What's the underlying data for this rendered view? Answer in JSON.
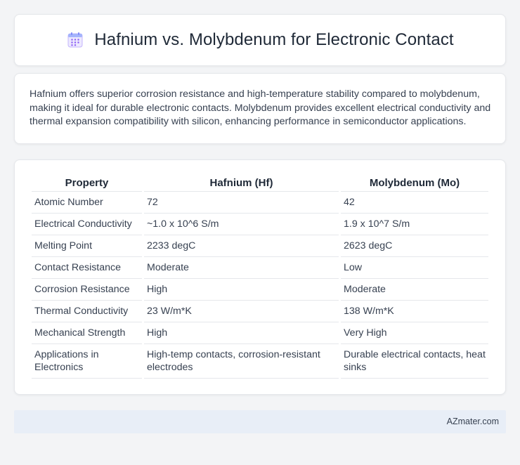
{
  "header": {
    "icon": "calendar-icon",
    "title": "Hafnium vs. Molybdenum for Electronic Contact"
  },
  "intro": {
    "text": "Hafnium offers superior corrosion resistance and high-temperature stability compared to molybdenum, making it ideal for durable electronic contacts. Molybdenum provides excellent electrical conductivity and thermal expansion compatibility with silicon, enhancing performance in semiconductor applications."
  },
  "table": {
    "headers": [
      "Property",
      "Hafnium (Hf)",
      "Molybdenum (Mo)"
    ],
    "rows": [
      [
        "Atomic Number",
        "72",
        "42"
      ],
      [
        "Electrical Conductivity",
        "~1.0 x 10^6 S/m",
        "1.9 x 10^7 S/m"
      ],
      [
        "Melting Point",
        "2233 degC",
        "2623 degC"
      ],
      [
        "Contact Resistance",
        "Moderate",
        "Low"
      ],
      [
        "Corrosion Resistance",
        "High",
        "Moderate"
      ],
      [
        "Thermal Conductivity",
        "23 W/m*K",
        "138 W/m*K"
      ],
      [
        "Mechanical Strength",
        "High",
        "Very High"
      ],
      [
        "Applications in Electronics",
        "High-temp contacts, corrosion-resistant electrodes",
        "Durable electrical contacts, heat sinks"
      ]
    ]
  },
  "footer": {
    "brand": "AZmater.com"
  }
}
